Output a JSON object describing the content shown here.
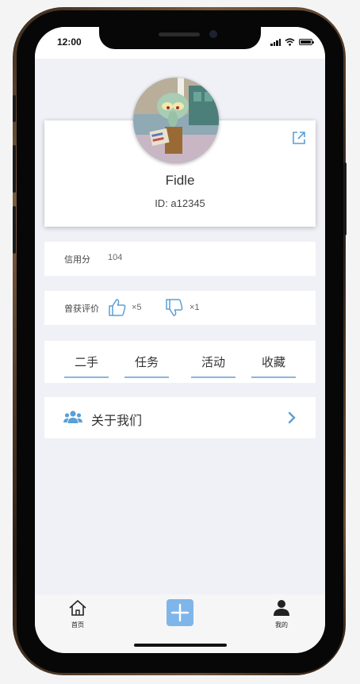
{
  "status_bar": {
    "time": "12:00"
  },
  "profile": {
    "name": "Fidle",
    "id_text": "ID: a12345"
  },
  "credit": {
    "label": "信用分",
    "value": "104"
  },
  "ratings": {
    "label": "曾获评价",
    "likes": "×5",
    "dislikes": "×1"
  },
  "tabs": [
    {
      "label": "二手"
    },
    {
      "label": "任务"
    },
    {
      "label": "活动"
    },
    {
      "label": "收藏"
    }
  ],
  "about": {
    "label": "关于我们"
  },
  "tabbar": {
    "home_label": "首页",
    "mine_label": "我的"
  },
  "colors": {
    "accent": "#7fb6ea",
    "tab_underline": "#8ab4df",
    "icon_blue": "#5a9fd6",
    "background": "#f0f1f6"
  },
  "icons": [
    "share-icon",
    "thumbs-up-icon",
    "thumbs-down-icon",
    "users-icon",
    "chevron-right-icon",
    "home-icon",
    "plus-icon",
    "user-icon"
  ]
}
